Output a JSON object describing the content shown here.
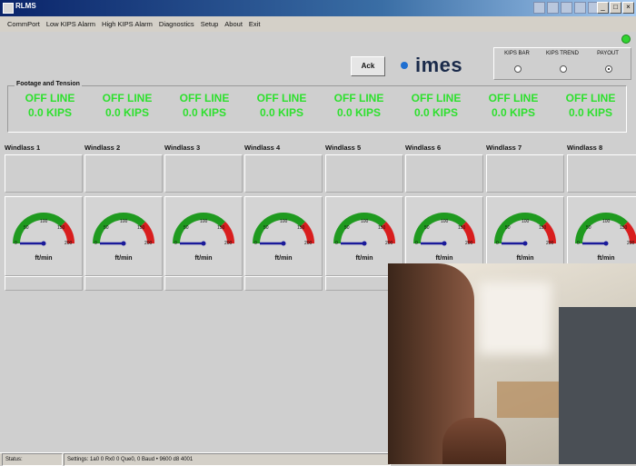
{
  "window": {
    "title": "RLMS"
  },
  "menu": [
    "CommPort",
    "Low KIPS Alarm",
    "High KIPS Alarm",
    "Diagnostics",
    "Setup",
    "About",
    "Exit"
  ],
  "toolbar": {
    "ack_label": "Ack",
    "logo_text": "imes"
  },
  "view_mode": {
    "options": [
      {
        "label": "KIPS BAR",
        "selected": false
      },
      {
        "label": "KIPS TREND",
        "selected": false
      },
      {
        "label": "PAYOUT",
        "selected": true
      }
    ]
  },
  "footage_tension": {
    "title": "Footage and Tension",
    "cells": [
      {
        "line1": "OFF LINE",
        "line2": "0.0 KIPS"
      },
      {
        "line1": "OFF LINE",
        "line2": "0.0 KIPS"
      },
      {
        "line1": "OFF LINE",
        "line2": "0.0 KIPS"
      },
      {
        "line1": "OFF LINE",
        "line2": "0.0 KIPS"
      },
      {
        "line1": "OFF LINE",
        "line2": "0.0 KIPS"
      },
      {
        "line1": "OFF LINE",
        "line2": "0.0 KIPS"
      },
      {
        "line1": "OFF LINE",
        "line2": "0.0 KIPS"
      },
      {
        "line1": "OFF LINE",
        "line2": "0.0 KIPS"
      }
    ],
    "color": "#2ee02e"
  },
  "windlasses": [
    {
      "name": "Windlass 1",
      "unit": "ft/min",
      "value": 0
    },
    {
      "name": "Windlass 2",
      "unit": "ft/min",
      "value": 0
    },
    {
      "name": "Windlass 3",
      "unit": "ft/min",
      "value": 0
    },
    {
      "name": "Windlass 4",
      "unit": "ft/min",
      "value": 0
    },
    {
      "name": "Windlass 5",
      "unit": "ft/min",
      "value": 0
    },
    {
      "name": "Windlass 6",
      "unit": "ft/min",
      "value": 0
    },
    {
      "name": "Windlass 7",
      "unit": "ft/min",
      "value": 0
    },
    {
      "name": "Windlass 8",
      "unit": "ft/min",
      "value": 0
    }
  ],
  "gauge": {
    "ticks": [
      "0",
      "50",
      "100",
      "150",
      "200"
    ],
    "max": 200,
    "green_until": 150,
    "colors": {
      "green": "#1f9a1f",
      "red": "#d81e1e",
      "needle": "#1a1a9a"
    }
  },
  "statusbar": {
    "status": "Status:",
    "settings": "Settings: 1a0  0 Rx0  0 Que0, 0 Baud • 9600  d8  4001"
  }
}
